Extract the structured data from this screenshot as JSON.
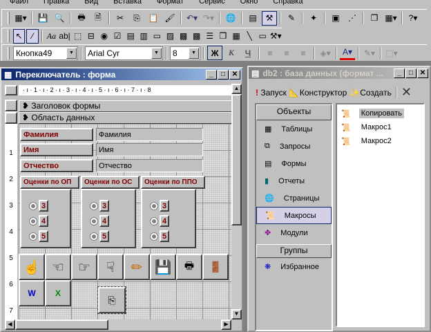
{
  "menu": [
    "Файл",
    "Правка",
    "Вид",
    "Вставка",
    "Формат",
    "Сервис",
    "Окно",
    "Справка"
  ],
  "toolbar3": {
    "object": "Кнопка49",
    "font": "Arial Cyr",
    "size": "8",
    "bold": "Ж",
    "italic": "К",
    "underline": "Ч"
  },
  "form_window": {
    "title": "Переключатель : форма",
    "ruler": "· ı · 1 · ı · 2 · ı · 3 · ı · 4 · ı · 5 · ı · 6 · ı · 7 · ı · 8",
    "vruler": [
      "1",
      "2",
      "3",
      "4",
      "5",
      "6",
      "7"
    ],
    "sections": [
      "Заголовок формы",
      "Область данных"
    ],
    "fields": [
      {
        "label": "Фамилия",
        "value": "Фамилия"
      },
      {
        "label": "Имя",
        "value": "Имя"
      },
      {
        "label": "Отчество",
        "value": "Отчество"
      }
    ],
    "groups": [
      {
        "title": "Оценки по ОП",
        "options": [
          "3",
          "4",
          "5"
        ]
      },
      {
        "title": "Оценки по ОС",
        "options": [
          "3",
          "4",
          "5"
        ]
      },
      {
        "title": "Оценки по ППО",
        "options": [
          "3",
          "4",
          "5"
        ]
      }
    ]
  },
  "db_window": {
    "title": "db2 : база данных (формат ...",
    "run": "Запуск",
    "design": "Конструктор",
    "create": "Создать",
    "objects_header": "Объекты",
    "objects": [
      "Таблицы",
      "Запросы",
      "Формы",
      "Отчеты",
      "Страницы",
      "Макросы",
      "Модули"
    ],
    "selected_object": "Макросы",
    "groups_header": "Группы",
    "groups": [
      "Избранное"
    ],
    "items": [
      "Копировать",
      "Макрос1",
      "Макрос2"
    ]
  }
}
